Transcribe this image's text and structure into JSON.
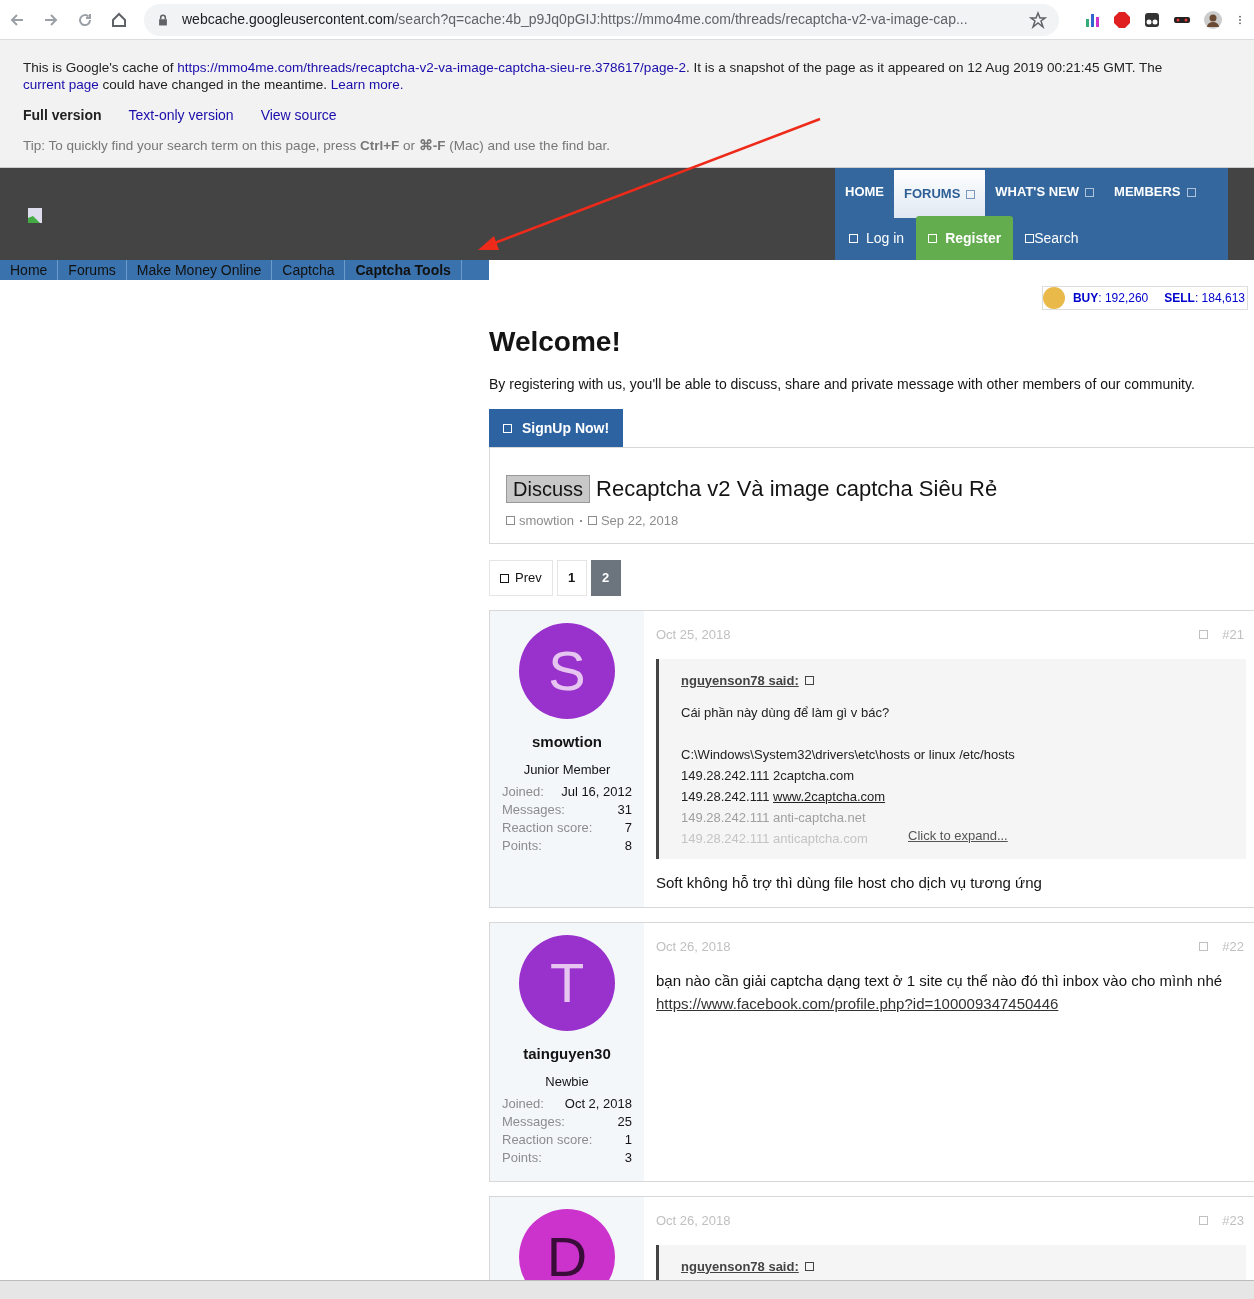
{
  "browser": {
    "url_host": "webcache.googleusercontent.com",
    "url_path": "/search?q=cache:4b_p9Jq0pGIJ:https://mmo4me.com/threads/recaptcha-v2-va-image-cap..."
  },
  "cache_notice": {
    "before": "This is Google's cache of ",
    "url": "https://mmo4me.com/threads/recaptcha-v2-va-image-captcha-sieu-re.378617/page-2",
    "middle": ". It is a snapshot of the page as it appeared on 12 Aug 2019 00:21:45 GMT. The ",
    "current": "current page",
    "after": " could have changed in the meantime. ",
    "learn": "Learn more.",
    "versions": [
      {
        "label": "Full version",
        "selected": true
      },
      {
        "label": "Text-only version",
        "selected": false
      },
      {
        "label": "View source",
        "selected": false
      }
    ],
    "tip": "Tip: To quickly find your search term on this page, press **Ctrl+F** or **⌘-F** (Mac) and use the find bar."
  },
  "nav": {
    "tabs": [
      {
        "label": "HOME",
        "selected": false,
        "menu": false
      },
      {
        "label": "FORUMS",
        "selected": true,
        "menu": true
      },
      {
        "label": "WHAT'S NEW",
        "selected": false,
        "menu": true
      },
      {
        "label": "MEMBERS",
        "selected": false,
        "menu": true
      }
    ],
    "actions": [
      {
        "label": "Log in",
        "kind": "plain"
      },
      {
        "label": "Register",
        "kind": "primary"
      },
      {
        "label": "Search",
        "kind": "search"
      }
    ]
  },
  "breadcrumbs": [
    {
      "label": "Home",
      "selected": false
    },
    {
      "label": "Forums",
      "selected": false
    },
    {
      "label": "Make Money Online",
      "selected": false
    },
    {
      "label": "Captcha",
      "selected": false
    },
    {
      "label": "Captcha Tools",
      "selected": true
    }
  ],
  "ticker": {
    "buy": "**BUY**: 192,260",
    "sell": "**SELL**: 184,613"
  },
  "welcome": {
    "title": "Welcome!",
    "text": "By registering with us, you'll be able to discuss, share and private message with other members of our community.",
    "button": "SignUp Now!"
  },
  "thread": {
    "prefix": "Discuss",
    "title": "Recaptcha v2 Và image captcha Siêu Rẻ",
    "author": "smowtion",
    "date": "Sep 22, 2018"
  },
  "pagination": {
    "prev": "Prev",
    "pages": [
      {
        "label": "1",
        "selected": false
      },
      {
        "label": "2",
        "selected": true
      }
    ]
  },
  "posts": [
    {
      "initial": "S",
      "color": "#9932cc",
      "username": "smowtion",
      "role": "Junior Member",
      "stats": [
        {
          "label": "Joined:",
          "value": "Jul 16, 2012"
        },
        {
          "label": "Messages:",
          "value": "31"
        },
        {
          "label": "Reaction score:",
          "value": "7"
        },
        {
          "label": "Points:",
          "value": "8"
        }
      ],
      "date": "Oct 25, 2018",
      "number": "#21",
      "quote": {
        "author": "nguyenson78 said:",
        "lines": [
          {
            "text": "Cái phần này dùng để làm gì v bác?",
            "faded": false
          },
          {
            "text": "C:\\Windows\\System32\\drivers\\etc\\hosts or linux /etc/hosts",
            "faded": false
          },
          {
            "text": "149.28.242.111 2captcha.com",
            "faded": false
          },
          {
            "text": "149.28.242.111 ",
            "link": "www.2captcha.com",
            "faded": false
          },
          {
            "text": "149.28.242.111 anti-captcha.net",
            "faded": true
          },
          {
            "text": "149.28.242.111 anticaptcha.com",
            "faded": true
          }
        ],
        "expand": "Click to expand..."
      },
      "body": "Soft không hỗ trợ thì dùng file host cho dịch vụ tương ứng"
    },
    {
      "initial": "T",
      "color": "#9932cc",
      "username": "tainguyen30",
      "role": "Newbie",
      "stats": [
        {
          "label": "Joined:",
          "value": "Oct 2, 2018"
        },
        {
          "label": "Messages:",
          "value": "25"
        },
        {
          "label": "Reaction score:",
          "value": "1"
        },
        {
          "label": "Points:",
          "value": "3"
        }
      ],
      "date": "Oct 26, 2018",
      "number": "#22",
      "body": "bạn nào cần giải captcha dạng text ở 1 site cụ thể nào đó thì inbox vào cho mình nhé",
      "link": "https://www.facebook.com/profile.php?id=100009347450446"
    },
    {
      "initial": "D",
      "color": "#cc33cc",
      "date": "Oct 26, 2018",
      "number": "#23",
      "quote": {
        "author": "nguyenson78 said:"
      }
    }
  ]
}
